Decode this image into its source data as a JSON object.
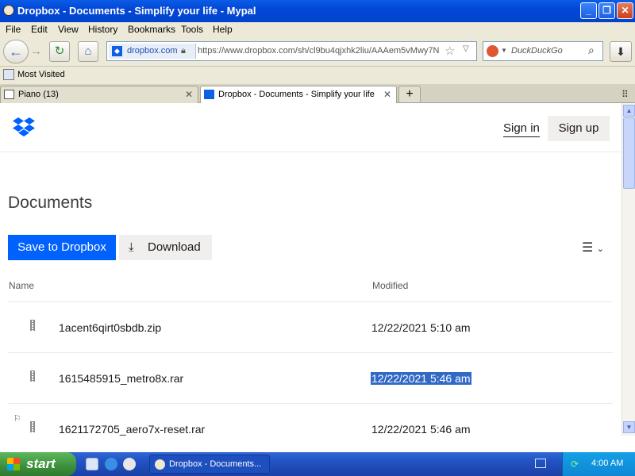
{
  "window": {
    "title": "Dropbox - Documents - Simplify your life - Mypal",
    "minimize": "_",
    "maximize": "❐",
    "close": "✕"
  },
  "menu": [
    "File",
    "Edit",
    "View",
    "History",
    "Bookmarks",
    "Tools",
    "Help"
  ],
  "nav": {
    "site_label": "dropbox.com",
    "url": "https://www.dropbox.com/sh/cl9bu4qjxhk2liu/AAAem5vMwy7N",
    "search_placeholder": "DuckDuckGo"
  },
  "bookmarks": {
    "most_visited": "Most Visited"
  },
  "tabs": [
    {
      "label": "Piano (13)"
    },
    {
      "label": "Dropbox - Documents - Simplify your life"
    }
  ],
  "page": {
    "sign_in": "Sign in",
    "sign_up": "Sign up",
    "title": "Documents",
    "save_to_dropbox": "Save to Dropbox",
    "download": "Download",
    "col_name": "Name",
    "col_modified": "Modified",
    "files": [
      {
        "name": "1acent6qirt0sbdb.zip",
        "modified": "12/22/2021 5:10 am"
      },
      {
        "name": "1615485915_metro8x.rar",
        "modified": "12/22/2021 5:46 am",
        "selected": true
      },
      {
        "name": "1621172705_aero7x-reset.rar",
        "modified": "12/22/2021 5:46 am"
      }
    ]
  },
  "taskbar": {
    "start": "start",
    "task_label": "Dropbox - Documents...",
    "clock": "4:00 AM"
  },
  "colors": {
    "titlebar": "#0347d8",
    "dropbox_blue": "#0061fe",
    "selection": "#3169c6",
    "start_green": "#3c8f3c"
  }
}
